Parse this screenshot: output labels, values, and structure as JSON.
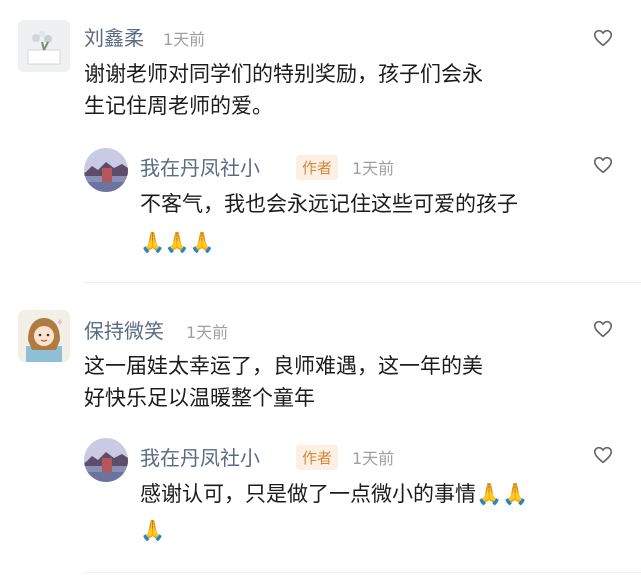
{
  "comments": [
    {
      "author": "刘鑫柔",
      "time": "1天前",
      "text": "谢谢老师对同学们的特别奖励，孩子们会永\n生记住周老师的爱。",
      "reply": {
        "author": "我在丹凤社小",
        "badge": "作者",
        "time": "1天前",
        "text": "不客气，我也会永远记住这些可爱的孩子",
        "emoji": "🙏🙏🙏"
      }
    },
    {
      "author": "保持微笑",
      "time": "1天前",
      "text": "这一届娃太幸运了，良师难遇，这一年的美\n好快乐足以温暖整个童年",
      "reply": {
        "author": "我在丹凤社小",
        "badge": "作者",
        "time": "1天前",
        "text": "感谢认可，只是做了一点微小的事情🙏🙏",
        "emoji": "🙏"
      }
    }
  ],
  "colors": {
    "author": "#5b6b84",
    "time": "#a0a0a0",
    "badge_text": "#d3893a",
    "badge_bg": "#fbf0e3",
    "divider": "#ececec"
  },
  "icons": {
    "like": "heart-outline-icon",
    "emoji": "pray-emoji"
  }
}
